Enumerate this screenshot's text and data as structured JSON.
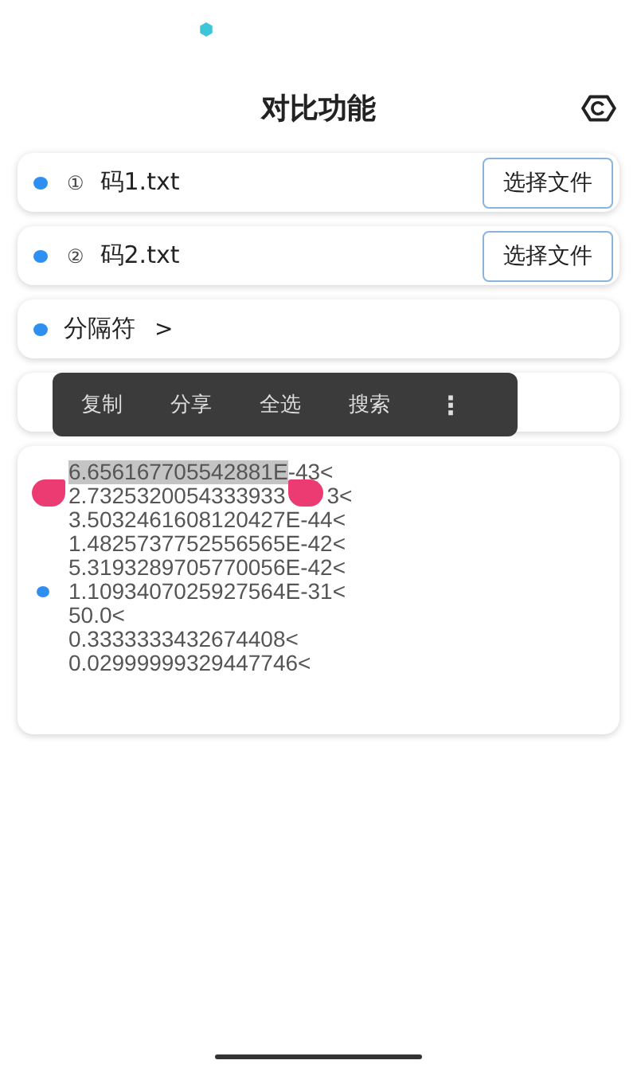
{
  "title": "对比功能",
  "files": [
    {
      "index": "①",
      "name": "码1.txt",
      "button": "选择文件"
    },
    {
      "index": "②",
      "name": "码2.txt",
      "button": "选择文件"
    }
  ],
  "separator": {
    "label": "分隔符",
    "value": ">"
  },
  "context_menu": [
    "复制",
    "分享",
    "全选",
    "搜索",
    "⋮"
  ],
  "output": {
    "lines": [
      {
        "highlight": "6.656167705542881E",
        "text": "-43<"
      },
      {
        "text": "2.7325320054333933",
        "tail": "3<"
      },
      {
        "text": "3.5032461608120427E-44<"
      },
      {
        "text": "1.4825737752556565E-42<"
      },
      {
        "text": "5.3193289705770056E-42<"
      },
      {
        "text": "1.1093407025927564E-31<"
      },
      {
        "text": "50.0<"
      },
      {
        "text": "0.3333333432674408<"
      },
      {
        "text": "0.02999999329447746<"
      }
    ]
  }
}
